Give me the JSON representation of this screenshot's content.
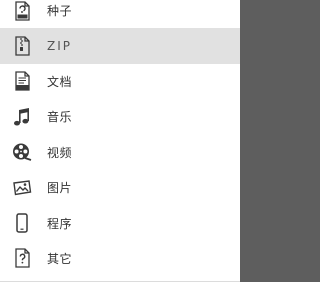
{
  "menu": {
    "items": [
      {
        "label": "种子",
        "icon": "torrent-file-icon"
      },
      {
        "label": "ZIP",
        "icon": "zip-file-icon",
        "selected": true
      },
      {
        "label": "文档",
        "icon": "doc-file-icon"
      },
      {
        "label": "音乐",
        "icon": "music-note-icon"
      },
      {
        "label": "视频",
        "icon": "film-reel-icon"
      },
      {
        "label": "图片",
        "icon": "picture-icon"
      },
      {
        "label": "程序",
        "icon": "phone-icon"
      },
      {
        "label": "其它",
        "icon": "question-file-icon"
      }
    ]
  },
  "colors": {
    "selected_background": "#e1e1e1",
    "overlay": "#5e5e5e",
    "drawer_background": "#ffffff"
  }
}
